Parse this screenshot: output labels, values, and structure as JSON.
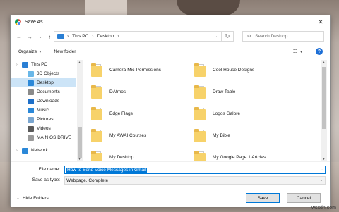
{
  "dialog": {
    "title": "Save As",
    "close_glyph": "✕"
  },
  "nav": {
    "back_glyph": "←",
    "forward_glyph": "→",
    "recent_glyph": "⌄",
    "up_glyph": "↑",
    "breadcrumb": [
      "This PC",
      "Desktop"
    ],
    "search_placeholder": "Search Desktop"
  },
  "toolbar": {
    "organize": "Organize",
    "new_folder": "New folder",
    "help": "?"
  },
  "sidebar": {
    "items": [
      {
        "label": "This PC",
        "icon": "computer-icon",
        "color": "#2a7fd4",
        "level": 0
      },
      {
        "label": "3D Objects",
        "icon": "cube-icon",
        "color": "#69b7e8",
        "level": 1
      },
      {
        "label": "Desktop",
        "icon": "desktop-icon",
        "color": "#2b88d8",
        "level": 1,
        "selected": true
      },
      {
        "label": "Documents",
        "icon": "documents-icon",
        "color": "#8a8a8a",
        "level": 1
      },
      {
        "label": "Downloads",
        "icon": "download-icon",
        "color": "#1e70c9",
        "level": 1
      },
      {
        "label": "Music",
        "icon": "music-icon",
        "color": "#2b88d8",
        "level": 1
      },
      {
        "label": "Pictures",
        "icon": "pictures-icon",
        "color": "#7aa6d0",
        "level": 1
      },
      {
        "label": "Videos",
        "icon": "videos-icon",
        "color": "#5a5a5a",
        "level": 1
      },
      {
        "label": "MAIN OS DRIVE",
        "icon": "drive-icon",
        "color": "#9a9a9a",
        "level": 1
      },
      {
        "label": "Network",
        "icon": "network-icon",
        "color": "#2b88d8",
        "level": 0
      }
    ]
  },
  "files": [
    {
      "name": "Camera-Mic-Permissions",
      "icon": "folder-icon"
    },
    {
      "name": "Cool House Designs",
      "icon": "folder-icon"
    },
    {
      "name": "DAtmos",
      "icon": "folder-icon"
    },
    {
      "name": "Draw Table",
      "icon": "folder-icon"
    },
    {
      "name": "Edge Flags",
      "icon": "folder-icon"
    },
    {
      "name": "Logos Galore",
      "icon": "folder-icon"
    },
    {
      "name": "My AWAI Courses",
      "icon": "folder-icon"
    },
    {
      "name": "My Bible",
      "icon": "folder-icon"
    },
    {
      "name": "My Desktop",
      "icon": "folder-icon"
    },
    {
      "name": "My Google Page 1 Artcles",
      "icon": "folder-icon"
    }
  ],
  "bottom": {
    "file_name_label": "File name:",
    "file_name_value": "How to Send Voice Messages in Gmail",
    "save_type_label": "Save as type:",
    "save_type_value": "Webpage, Complete",
    "hide_folders": "Hide Folders",
    "save": "Save",
    "cancel": "Cancel"
  },
  "watermark": "wsxdn.com",
  "colors": {
    "accent": "#0078d7",
    "selection": "#cce4f7",
    "folder": "#f7d26a"
  }
}
